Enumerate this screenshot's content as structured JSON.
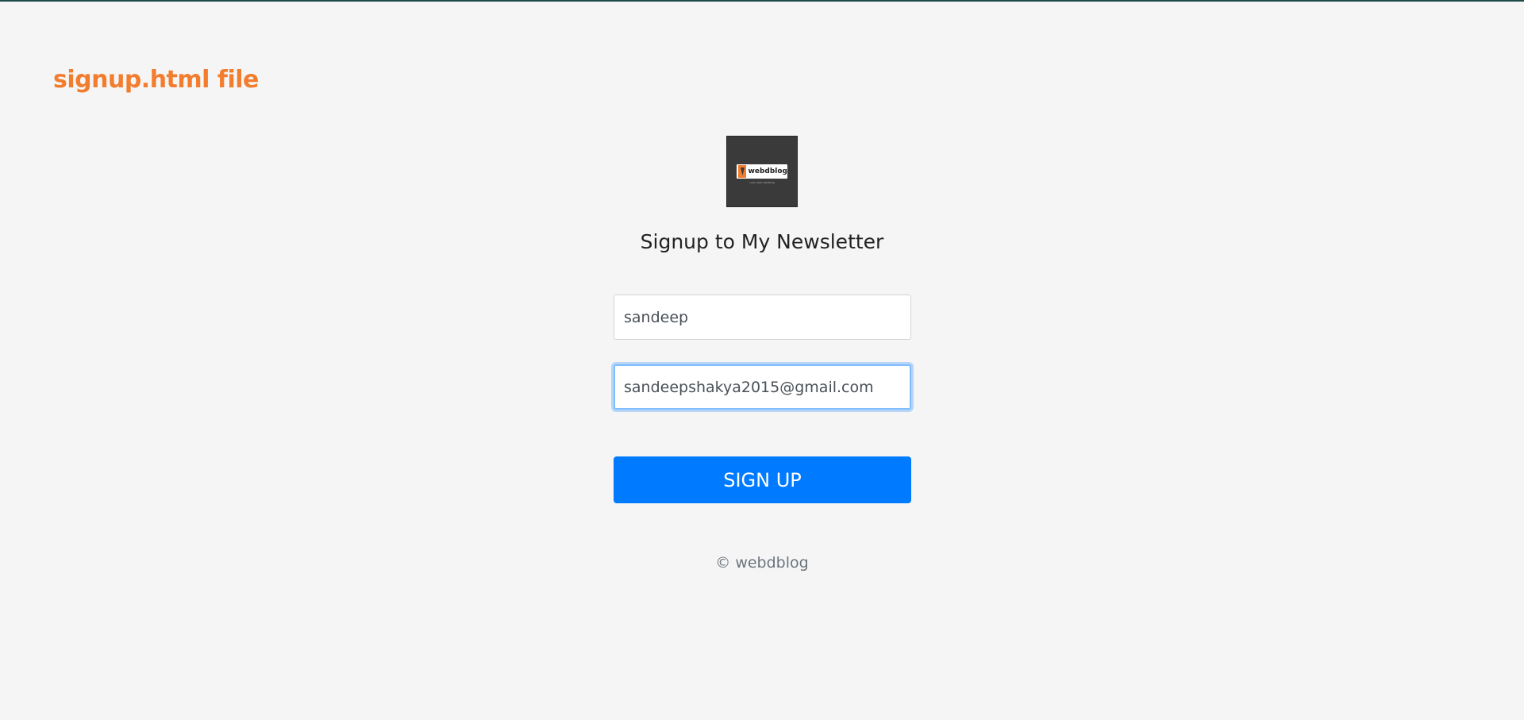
{
  "caption": "signup.html file",
  "logo": {
    "icon": "webdblog-logo",
    "text": "webdblog",
    "tagline": "Learn with webdblog"
  },
  "heading": "Signup to My Newsletter",
  "form": {
    "name_value": "sandeep",
    "email_value": "sandeepshakya2015@gmail.com",
    "submit_label": "SIGN UP"
  },
  "footer": "© webdblog",
  "colors": {
    "caption": "#f37d2f",
    "button": "#007bff",
    "background": "#f5f5f5"
  }
}
